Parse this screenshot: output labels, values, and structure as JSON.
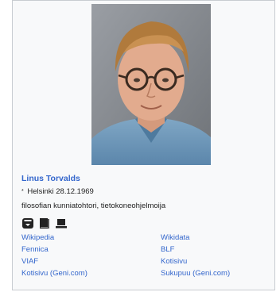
{
  "person": {
    "name": "Linus Torvalds",
    "birth_symbol": "*",
    "birth": "Helsinki 28.12.1969",
    "description": "filosofian kunniatohtori, tietokoneohjelmoija"
  },
  "icons": [
    "id-card-icon",
    "book-icon",
    "laptop-icon"
  ],
  "links": {
    "left": [
      "Wikipedia",
      "Fennica",
      "VIAF",
      "Kotisivu (Geni.com)"
    ],
    "right": [
      "Wikidata",
      "BLF",
      "Kotisivu",
      "Sukupuu (Geni.com)"
    ]
  },
  "colors": {
    "link": "#3366cc",
    "text": "#222222",
    "border": "#c8ccd1",
    "background": "#f8f9fa"
  }
}
